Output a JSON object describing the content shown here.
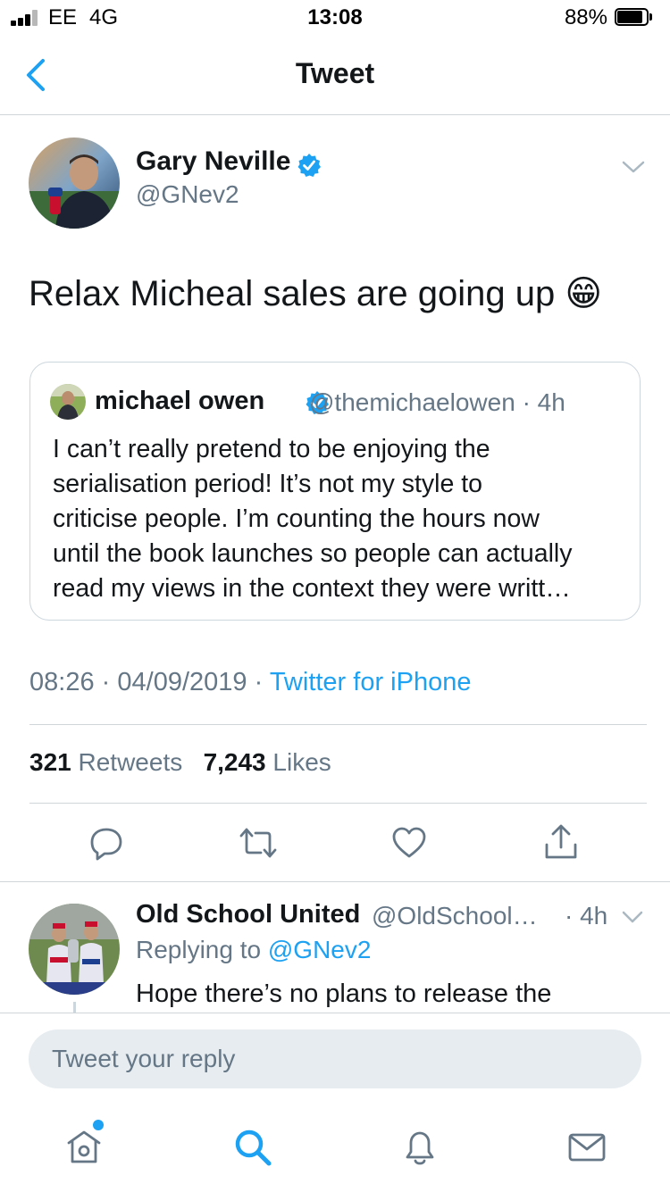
{
  "status_bar": {
    "carrier": "EE",
    "network": "4G",
    "time": "13:08",
    "battery": "88%",
    "battery_level": 0.88
  },
  "nav": {
    "title": "Tweet",
    "back_icon": "chevron-left-icon"
  },
  "tweet": {
    "author_name": "Gary Neville",
    "author_handle": "@GNev2",
    "text": "Relax Micheal sales are going up 😁",
    "quote": {
      "name": "michael owen",
      "handle": "@themichaelowen",
      "time": "· 4h",
      "lines": [
        "I can’t really pretend to be enjoying the",
        "serialisation period! It’s not my style to",
        "criticise people. I’m counting the hours now",
        "until the book launches so people can actually",
        "read my views in the context they were writt…"
      ]
    },
    "time": "08:26",
    "date": "04/09/2019",
    "separator": "·",
    "source": "Twitter for iPhone",
    "retweets_count": "321",
    "retweets_label": "Retweets",
    "likes_count": "7,243",
    "likes_label": "Likes"
  },
  "actions": [
    "reply-icon",
    "retweet-icon",
    "like-icon",
    "share-icon"
  ],
  "reply": {
    "name": "Old School United",
    "handle": "@OldSchool…",
    "time": "· 4h",
    "replying_prefix": "Replying to",
    "replying_handle": "@GNev2",
    "text": "Hope there’s no plans to release the"
  },
  "composer": {
    "placeholder": "Tweet your reply"
  },
  "tab_bar": [
    "home-icon",
    "search-icon",
    "notifications-icon",
    "messages-icon"
  ],
  "colors": {
    "accent": "#1da1f2",
    "secondary_text": "#657786",
    "divider": "#d0d5d9"
  }
}
